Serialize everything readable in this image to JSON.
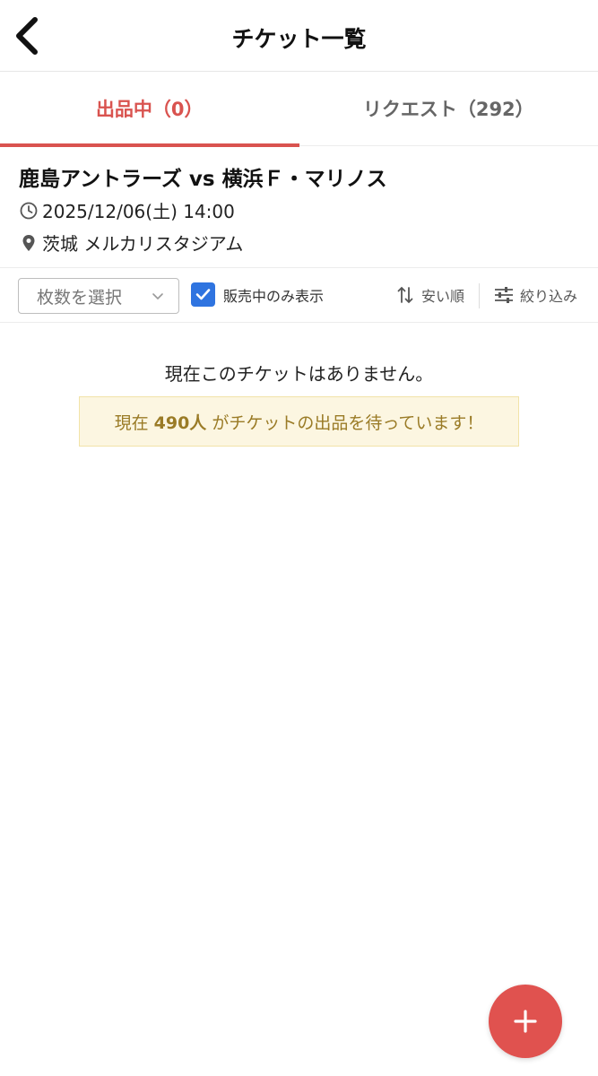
{
  "header": {
    "title": "チケット一覧",
    "back_icon": "chevron-left-icon"
  },
  "tabs": [
    {
      "label": "出品中（0）",
      "active": true
    },
    {
      "label": "リクエスト（292）",
      "active": false
    }
  ],
  "event": {
    "title": "鹿島アントラーズ vs 横浜Ｆ・マリノス",
    "datetime": "2025/12/06(土) 14:00",
    "venue": "茨城 メルカリスタジアム"
  },
  "filters": {
    "quantity_select": "枚数を選択",
    "only_selling_label": "販売中のみ表示",
    "only_selling_checked": true,
    "sort_label": "安い順",
    "filter_label": "絞り込み"
  },
  "empty_state": {
    "message": "現在このチケットはありません。",
    "waiting_prefix": "現在",
    "waiting_count": "490人",
    "waiting_suffix": "がチケットの出品を待っています！"
  },
  "colors": {
    "accent": "#d9534f",
    "checkbox": "#2f74e0",
    "notice_bg": "#fcf6e1",
    "notice_text": "#9a7b26"
  },
  "fab": {
    "icon": "plus-icon"
  }
}
